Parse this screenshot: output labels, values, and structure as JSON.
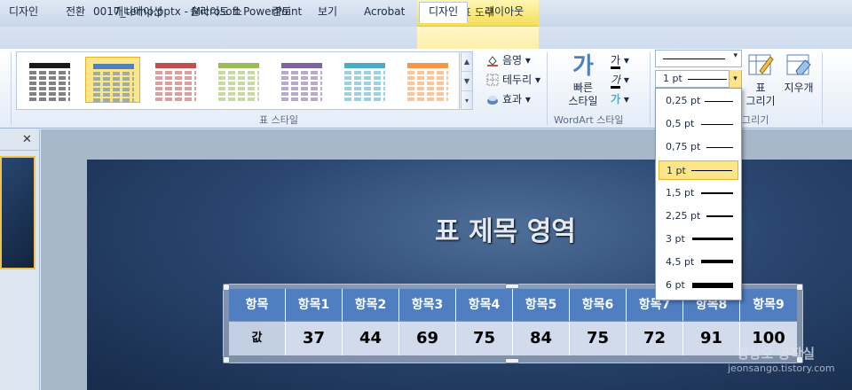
{
  "window": {
    "title": "0017_temp.pptx  -  Microsoft PowerPoint",
    "tool_tab_header": "표 도구"
  },
  "tabs": [
    {
      "label": "디자인",
      "active": false
    },
    {
      "label": "전환",
      "active": false
    },
    {
      "label": "애니메이션",
      "active": false
    },
    {
      "label": "슬라이드 쇼",
      "active": false
    },
    {
      "label": "검토",
      "active": false
    },
    {
      "label": "보기",
      "active": false
    },
    {
      "label": "Acrobat",
      "active": false
    },
    {
      "label": "디자인",
      "active": true
    },
    {
      "label": "레이아웃",
      "active": false
    }
  ],
  "ribbon": {
    "table_styles_label": "표 스타일",
    "shading_label": "음영",
    "borders_label": "테두리",
    "effects_label": "효과",
    "quick_styles_line1": "빠른",
    "quick_styles_line2": "스타일",
    "wordart_label": "WordArt 스타일",
    "draw_group_label": "그리기",
    "draw_table_line1": "표",
    "draw_table_line2": "그리기",
    "eraser_label": "지우개",
    "pen_weight_value": "1 pt",
    "text_fill_glyph": "가",
    "text_outline_glyph": "가",
    "text_effects_glyph": "가",
    "gallery_colors": [
      "#1a1a1a",
      "#4f81bd",
      "#c0504d",
      "#9bbb59",
      "#8064a2",
      "#4bacc6",
      "#f79646"
    ]
  },
  "line_weights": [
    {
      "label": "0,25 pt",
      "weight": 0.25,
      "selected": false
    },
    {
      "label": "0,5 pt",
      "weight": 0.5,
      "selected": false
    },
    {
      "label": "0,75 pt",
      "weight": 0.75,
      "selected": false
    },
    {
      "label": "1 pt",
      "weight": 1,
      "selected": true
    },
    {
      "label": "1,5 pt",
      "weight": 1.5,
      "selected": false
    },
    {
      "label": "2,25 pt",
      "weight": 2.25,
      "selected": false
    },
    {
      "label": "3 pt",
      "weight": 3,
      "selected": false
    },
    {
      "label": "4,5 pt",
      "weight": 4.5,
      "selected": false
    },
    {
      "label": "6 pt",
      "weight": 6,
      "selected": false
    }
  ],
  "slide": {
    "title": "표 제목 영역",
    "table": {
      "headers": [
        "항목",
        "항목1",
        "항목2",
        "항목3",
        "항목4",
        "항목5",
        "항목6",
        "항목7",
        "항목8",
        "항목9"
      ],
      "row": [
        "값",
        "37",
        "44",
        "69",
        "75",
        "84",
        "75",
        "72",
        "91",
        "100"
      ]
    }
  },
  "watermark": {
    "line1": "정상오 공작실",
    "line2": "jeonsango.tistory.com"
  },
  "icons": {
    "close": "close-icon",
    "dropdown": "chevron-down-icon"
  }
}
